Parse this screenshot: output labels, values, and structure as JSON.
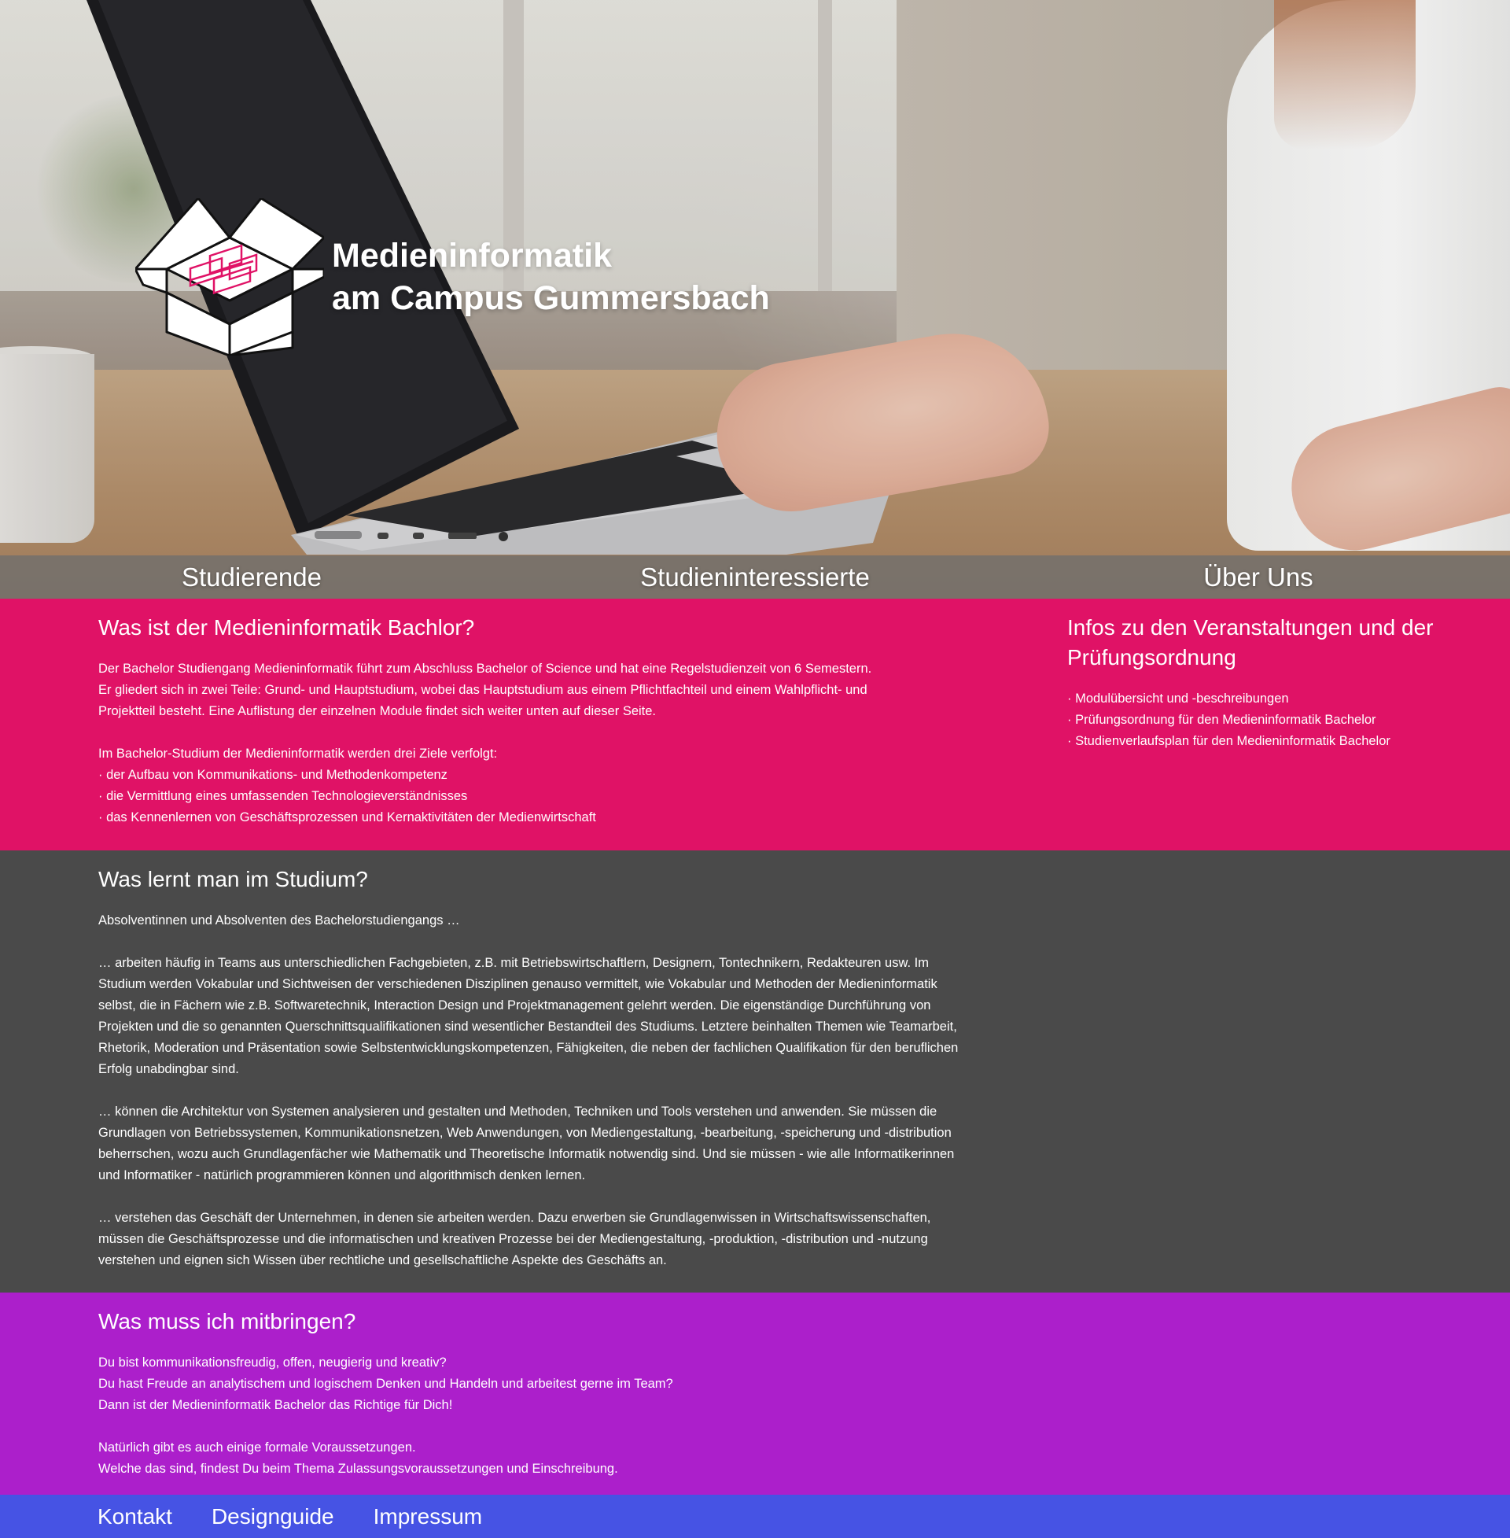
{
  "hero": {
    "title_line1": "Medieninformatik",
    "title_line2": "am Campus Gummersbach"
  },
  "nav": {
    "items": [
      "Studierende",
      "Studieninteressierte",
      "Über Uns"
    ]
  },
  "bachelor": {
    "heading": "Was ist der Medieninformatik Bachlor?",
    "intro_lines": [
      "Der Bachelor Studiengang Medieninformatik führt zum Abschluss Bachelor of Science und hat eine Regelstudienzeit von 6 Semestern.",
      "Er gliedert sich in zwei Teile: Grund- und Hauptstudium, wobei das Hauptstudium aus einem Pflichtfachteil und einem Wahlpflicht- und",
      "Projektteil besteht. Eine Auflistung der einzelnen Module findet sich weiter unten auf dieser Seite."
    ],
    "goals_intro": "Im Bachelor-Studium der Medieninformatik werden drei Ziele verfolgt:",
    "goals": [
      "· der Aufbau von Kommunikations- und Methodenkompetenz",
      "· die Vermittlung eines umfassenden Technologieverständnisses",
      "· das Kennenlernen von Geschäftsprozessen und Kernaktivitäten der Medienwirtschaft"
    ]
  },
  "infos": {
    "heading": "Infos zu den Veranstaltungen und der Prüfungsordnung",
    "links": [
      "· Modulübersicht und -beschreibungen",
      "· Prüfungsordnung für den Medieninformatik Bachelor",
      "· Studienverlaufsplan für den Medieninformatik Bachelor"
    ]
  },
  "learn": {
    "heading": "Was lernt man im Studium?",
    "intro": "Absolventinnen und Absolventen des Bachelorstudiengangs …",
    "para1_lines": [
      "… arbeiten häufig in Teams aus unterschiedlichen Fachgebieten, z.B. mit Betriebswirtschaftlern, Designern, Tontechnikern, Redakteuren usw. Im",
      "Studium werden Vokabular und Sichtweisen der verschiedenen Disziplinen genauso vermittelt, wie Vokabular und Methoden der Medieninformatik",
      "selbst, die in Fächern wie z.B. Softwaretechnik, Interaction Design und Projektmanagement gelehrt werden. Die eigenständige Durchführung von",
      "Projekten und die so genannten Querschnittsqualifikationen sind wesentlicher Bestandteil des Studiums. Letztere beinhalten Themen wie Teamarbeit,",
      "Rhetorik, Moderation und Präsentation sowie Selbstentwicklungskompetenzen, Fähigkeiten, die neben der fachlichen Qualifikation für den beruflichen",
      "Erfolg unabdingbar sind."
    ],
    "para2_lines": [
      "… können die Architektur von Systemen analysieren und gestalten und Methoden, Techniken und Tools verstehen und anwenden. Sie müssen die",
      "Grundlagen von Betriebssystemen, Kommunikationsnetzen, Web Anwendungen, von Mediengestaltung, -bearbeitung, -speicherung und -distribution",
      "beherrschen, wozu auch Grundlagenfächer wie Mathematik und Theoretische Informatik notwendig sind. Und sie müssen - wie alle Informatikerinnen",
      "und Informatiker - natürlich programmieren können und algorithmisch denken lernen."
    ],
    "para3_lines": [
      "… verstehen das Geschäft der Unternehmen, in denen sie arbeiten werden. Dazu erwerben sie Grundlagenwissen in Wirtschaftswissenschaften,",
      "müssen die Geschäftsprozesse und die informatischen und kreativen Prozesse bei der Mediengestaltung, -produktion, -distribution und -nutzung",
      "verstehen und eignen sich Wissen über rechtliche und gesellschaftliche Aspekte des Geschäfts an."
    ]
  },
  "bring": {
    "heading": "Was muss ich mitbringen?",
    "lines1": [
      "Du bist kommunikationsfreudig, offen, neugierig und kreativ?",
      "Du hast Freude an analytischem und logischem Denken und Handeln und arbeitest gerne im Team?",
      "Dann ist der Medieninformatik Bachelor das Richtige für Dich!"
    ],
    "lines2": [
      "Natürlich gibt es auch einige formale Voraussetzungen.",
      "Welche das sind, findest Du beim Thema Zulassungsvoraussetzungen und Einschreibung."
    ]
  },
  "footer": {
    "links": [
      "Kontakt",
      "Designguide",
      "Impressum"
    ]
  },
  "colors": {
    "pink": "#e01266",
    "gray": "#4a4a4a",
    "purple": "#ac1fcb",
    "footer_blue": "#4653e4",
    "logo_accent": "#e01266"
  },
  "icons": {
    "logo": "open-box-logo-icon"
  }
}
